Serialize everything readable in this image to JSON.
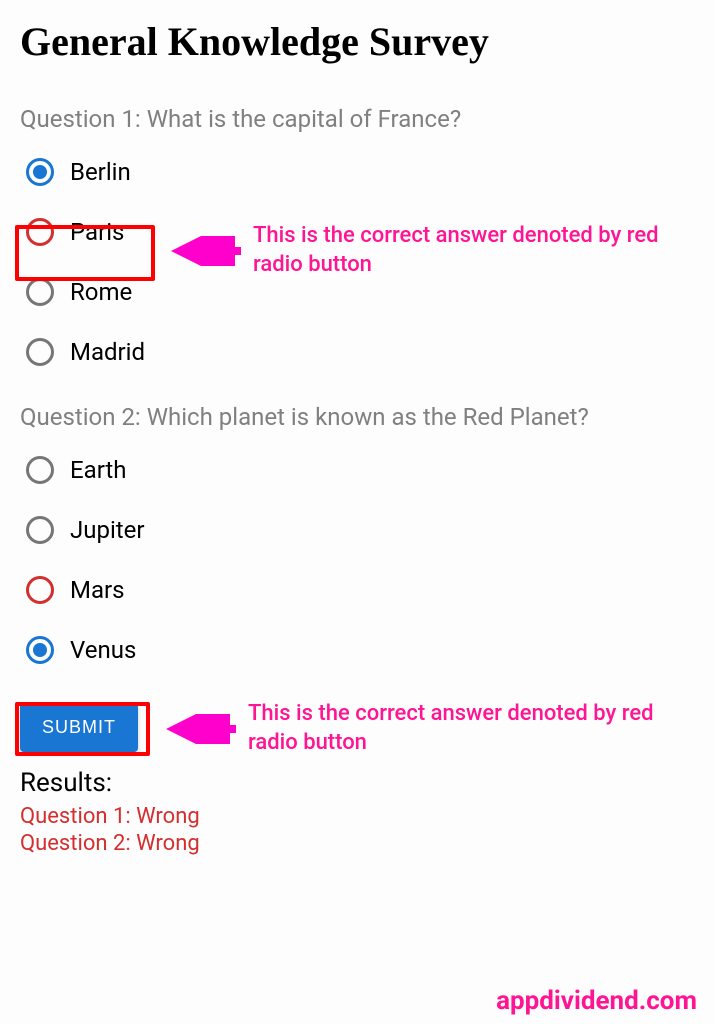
{
  "title": "General Knowledge Survey",
  "questions": [
    {
      "prompt": "Question 1: What is the capital of France?",
      "options": [
        "Berlin",
        "Paris",
        "Rome",
        "Madrid"
      ],
      "selected_index": 0,
      "correct_index": 1
    },
    {
      "prompt": "Question 2: Which planet is known as the Red Planet?",
      "options": [
        "Earth",
        "Jupiter",
        "Mars",
        "Venus"
      ],
      "selected_index": 3,
      "correct_index": 2
    }
  ],
  "annotations": [
    {
      "text": "This is the correct answer denoted by red radio button"
    },
    {
      "text": "This is the correct answer denoted by red radio button"
    }
  ],
  "submit_label": "SUBMIT",
  "results": {
    "heading": "Results:",
    "lines": [
      "Question 1: Wrong",
      "Question 2: Wrong"
    ]
  },
  "watermark": "appdividend.com",
  "colors": {
    "accent": "#1976d2",
    "correct_highlight": "#ff0000",
    "annotation": "#ff1493",
    "error_text": "#d32f2f"
  }
}
